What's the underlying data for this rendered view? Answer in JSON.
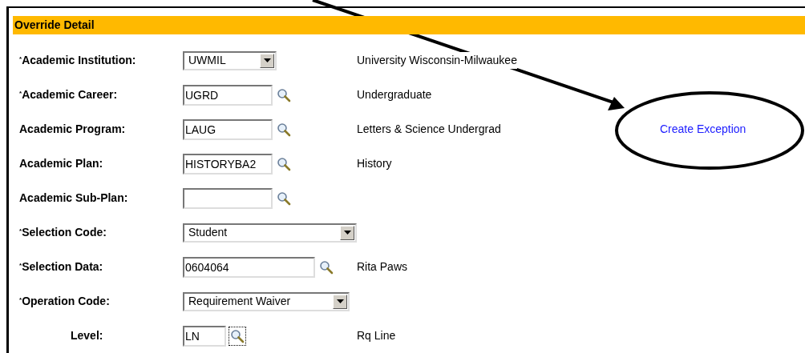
{
  "section": {
    "title": "Override Detail"
  },
  "rows": [
    {
      "label": "$^{*}$Academic Institution:",
      "kind": "select",
      "value": "UWMIL",
      "description": "University Wisconsin-Milwaukee"
    },
    {
      "label": "$^{*}$Academic Career:",
      "kind": "lookup",
      "value": "UGRD",
      "focused": false,
      "description": "Undergraduate"
    },
    {
      "label": "Academic Program:",
      "kind": "lookup",
      "value": "LAUG",
      "focused": false,
      "description": "Letters & Science Undergrad",
      "link": "Create Exception"
    },
    {
      "label": "Academic Plan:",
      "kind": "lookup",
      "value": "HISTORYBA2",
      "focused": false,
      "description": "History"
    },
    {
      "label": "Academic Sub-Plan:",
      "kind": "lookup",
      "focused": false
    },
    {
      "label": "$^{*}$Selection Code:",
      "kind": "select",
      "value": "Student"
    },
    {
      "label": "$^{*}$Selection Data:",
      "kind": "lookup",
      "value": "0604064",
      "focused": false,
      "description": "Rita Paws"
    },
    {
      "label": "$^{*}$Operation Code:",
      "kind": "select",
      "value": "Requirement Waiver"
    },
    {
      "label": "Level:",
      "kind": "lookup",
      "value": "LN",
      "focused": true,
      "description": "Rq Line"
    }
  ]
}
